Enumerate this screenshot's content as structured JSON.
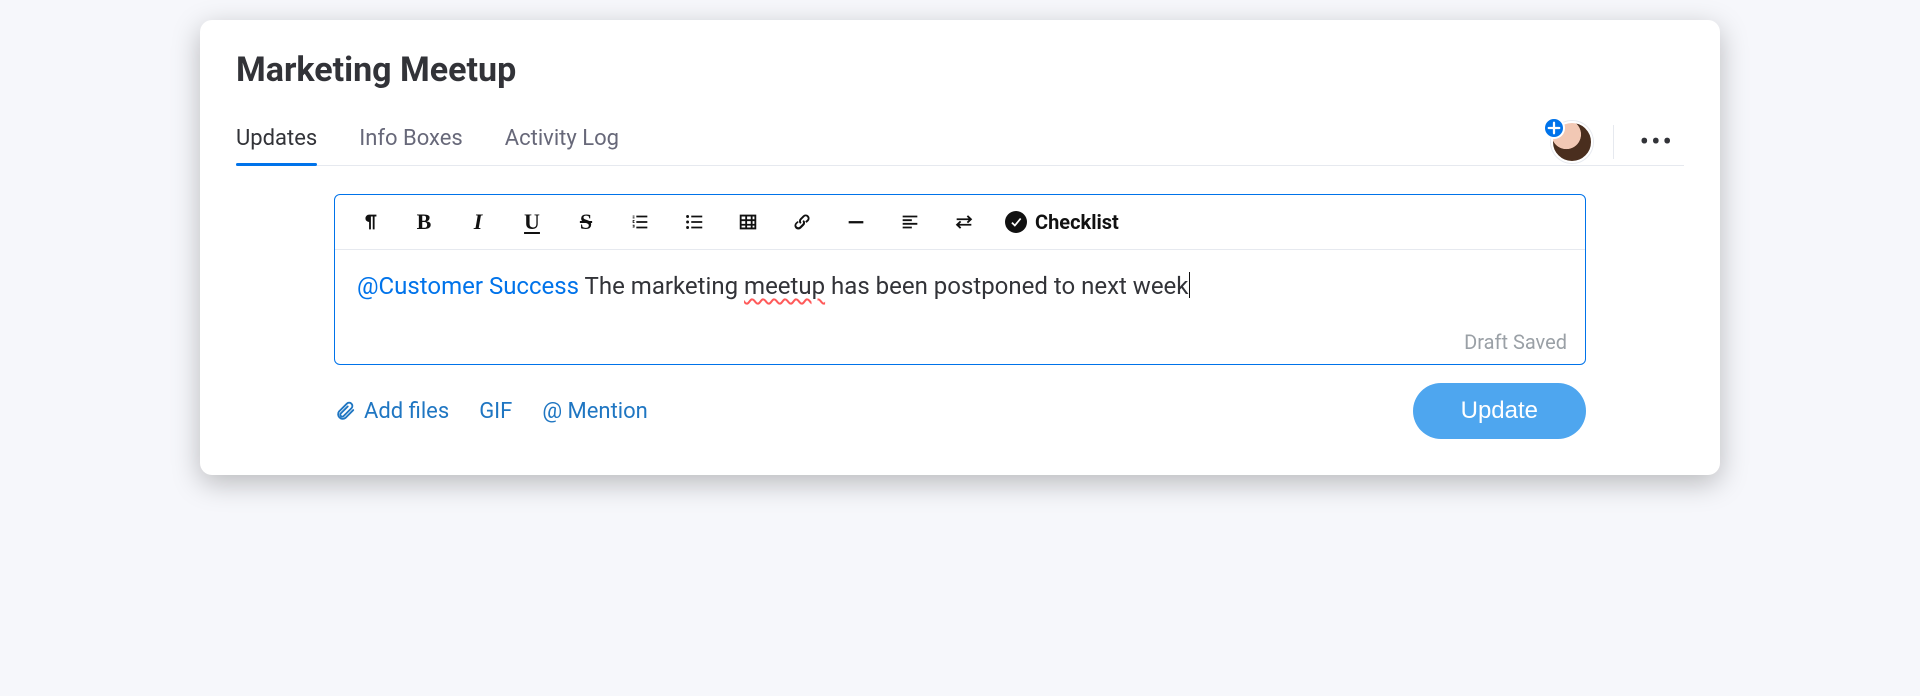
{
  "title": "Marketing Meetup",
  "tabs": [
    {
      "label": "Updates",
      "active": true
    },
    {
      "label": "Info Boxes",
      "active": false
    },
    {
      "label": "Activity Log",
      "active": false
    }
  ],
  "toolbar": {
    "checklist_label": "Checklist"
  },
  "editor": {
    "mention": "@Customer Success",
    "before_misspell": " The marketing ",
    "misspelled": "meetup",
    "after_misspell": " has been postponed to next week",
    "draft_status": "Draft Saved"
  },
  "actions": {
    "add_files": "Add files",
    "gif": "GIF",
    "mention": "@ Mention",
    "update": "Update"
  }
}
